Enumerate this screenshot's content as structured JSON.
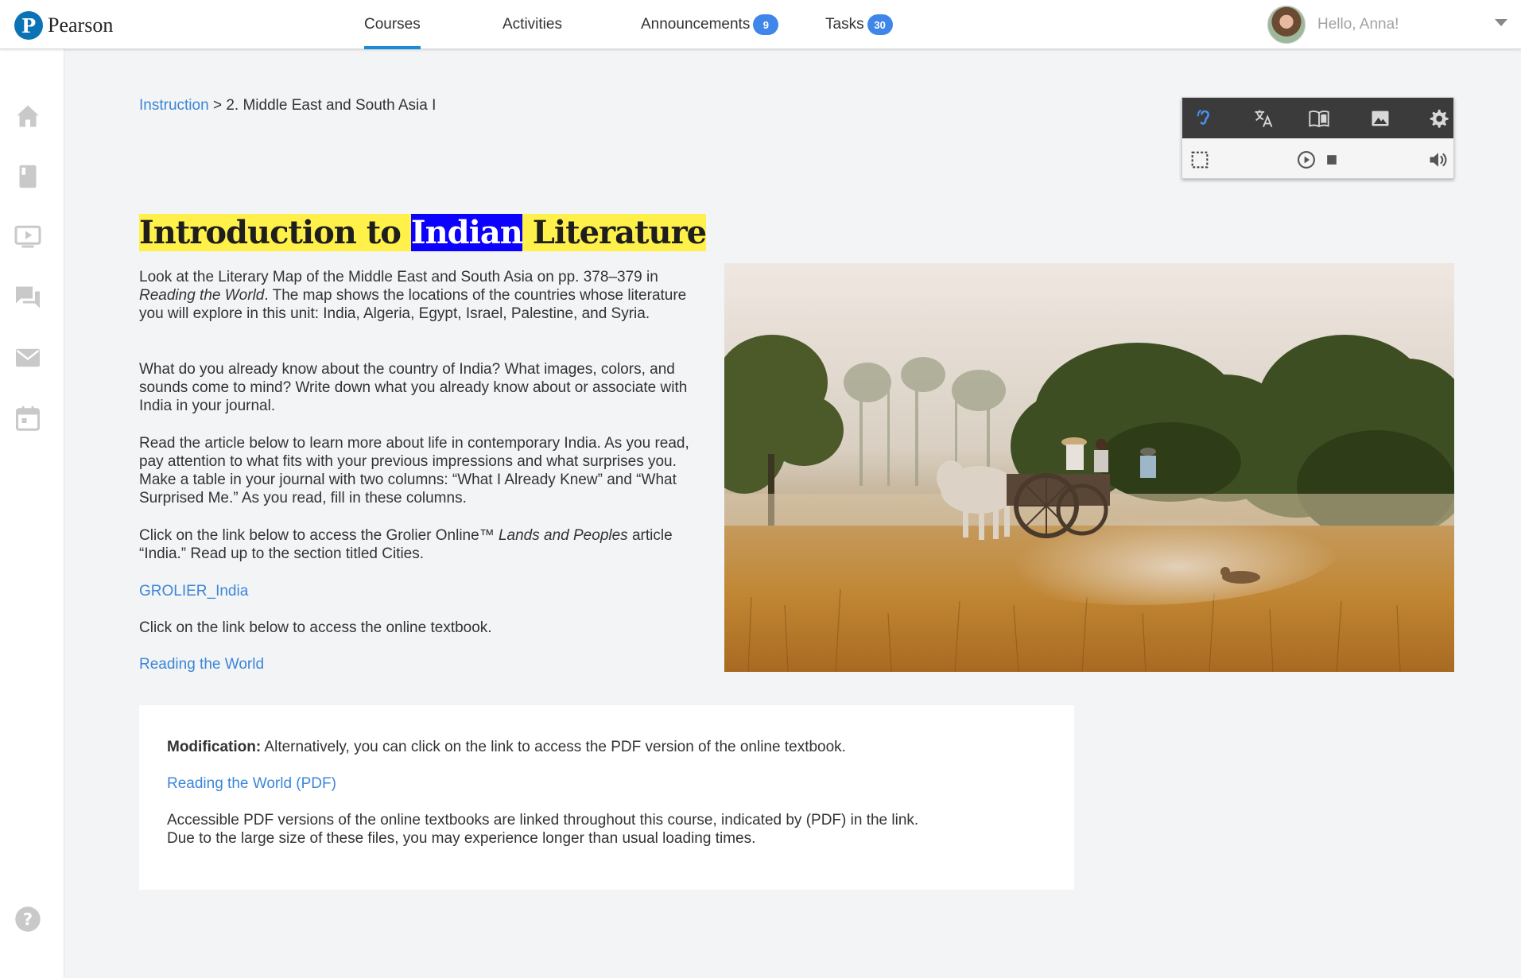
{
  "header": {
    "brand": "Pearson",
    "brand_initial": "P",
    "nav": {
      "courses": "Courses",
      "activities": "Activities",
      "announcements": "Announcements",
      "announcements_count": "9",
      "tasks": "Tasks",
      "tasks_count": "30"
    },
    "greeting": "Hello, Anna!"
  },
  "sidebar": {
    "items": [
      "home-icon",
      "book-icon",
      "video-icon",
      "chat-icon",
      "mail-icon",
      "calendar-icon",
      "help-icon"
    ]
  },
  "breadcrumb": {
    "root": "Instruction",
    "separator": ">",
    "current": "2. Middle East and South Asia I"
  },
  "tools": {
    "top": [
      "listen-icon",
      "translate-icon",
      "dictionary-icon",
      "picture-dictionary-icon",
      "settings-icon"
    ],
    "bottom": [
      "select-area-icon",
      "play-icon",
      "stop-icon",
      "volume-icon"
    ]
  },
  "lesson": {
    "title_part1": "Introduction to ",
    "title_part2": "Indian",
    "title_part3": " Literature",
    "p1_a": "Look at the Literary Map of the Middle East and South Asia on pp. 378–379 in ",
    "p1_em": "Reading the World",
    "p1_b": ". The map shows the locations of the countries whose literature you will explore in this unit: India, Algeria, Egypt, Israel, Palestine, and Syria.",
    "p2": "What do you already know about the country of India? What images, colors, and sounds come to mind? Write down what you already know about or asso­ciate with India in your journal.",
    "p3": "Read the article below to learn more about life in contemporary India. As you read, pay attention to what fits with your previous impressions and what surprises you. Make a table in your journal with two columns: “What I Already Knew” and “What Surprised Me.” As you read, fill in these columns.",
    "p4_a": "Click on the link below to access the Grolier Online™ ",
    "p4_em": "Lands and Peoples",
    "p4_b": " article “India.” Read up to the section titled Cities.",
    "link1": "GROLIER_India",
    "p5": "Click on the link below to access the online textbook.",
    "link2": "Reading the World"
  },
  "modification": {
    "label": "Modification:",
    "text": " Alternatively, you can click on the link to access the PDF version of the online textbook.",
    "link": "Reading the World (PDF)",
    "note_line1": "Accessible PDF versions of the online textbooks are linked throughout this course, indicated by (PDF) in the link.",
    "note_line2": "Due to the large size of these files, you may experience longer than usual loading times."
  },
  "colors": {
    "accent": "#3b86d8",
    "badge": "#3f86ea",
    "highlight_yellow": "#fff14a",
    "highlight_blue": "#0c00ff",
    "toolbar": "#3b3b3b"
  }
}
